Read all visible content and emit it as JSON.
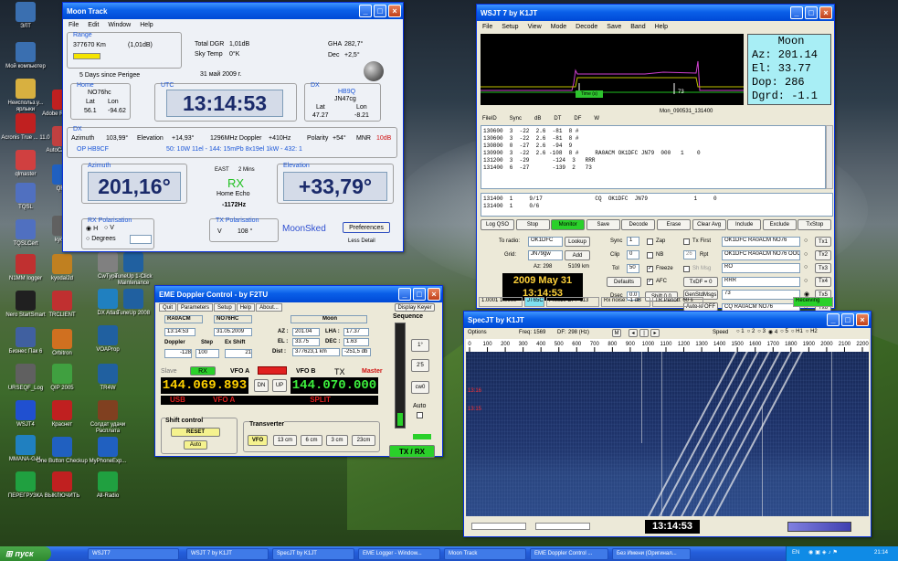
{
  "desktop": {
    "col1": [
      {
        "label": "ЭЛТ",
        "icon": "computer-icon",
        "color": "#3a6fb0"
      },
      {
        "label": "Мой компьютер",
        "icon": "computer-icon",
        "color": "#3a6fb0"
      },
      {
        "label": "Неиспольз.у... ярлыки",
        "icon": "folder-icon",
        "color": "#d8b040"
      },
      {
        "label": "Acronis True ... 11.0",
        "icon": "disc-icon",
        "color": "#c02020"
      },
      {
        "label": "qlmaster",
        "icon": "app-icon",
        "color": "#d04040"
      },
      {
        "label": "TQSL",
        "icon": "app-icon",
        "color": "#5070c0"
      },
      {
        "label": "TQSLCert",
        "icon": "app-icon",
        "color": "#5070c0"
      },
      {
        "label": "N1MM logger",
        "icon": "logger-icon",
        "color": "#c03030"
      },
      {
        "label": "Nero StartSmart",
        "icon": "disc-icon",
        "color": "#202020"
      },
      {
        "label": "Бизнес Пак 6",
        "icon": "app-icon",
        "color": "#4060a0"
      },
      {
        "label": "URSEQF_Log",
        "icon": "app-icon",
        "color": "#606060"
      },
      {
        "label": "WSJT4",
        "icon": "app-icon",
        "color": "#2050d0"
      },
      {
        "label": "MMANA-GAL",
        "icon": "antenna-icon",
        "color": "#2080c0"
      },
      {
        "label": "ПЕРЕГРУЗКА",
        "icon": "app-icon",
        "color": "#20a040"
      }
    ],
    "col2": [
      {
        "label": "Adobe Reader 9",
        "icon": "pdf-icon",
        "color": "#c02020"
      },
      {
        "label": "AutoCAD CB",
        "icon": "app-icon",
        "color": "#c04040"
      },
      {
        "label": "QRZ",
        "icon": "app-icon",
        "color": "#2060c0"
      },
      {
        "label": "kyoda",
        "icon": "app-icon",
        "color": "#606060"
      },
      {
        "label": "kyodai2d",
        "icon": "app-icon",
        "color": "#c08020"
      },
      {
        "label": "TRCLIENT",
        "icon": "app-icon",
        "color": "#c03030"
      },
      {
        "label": "Orbitron",
        "icon": "app-icon",
        "color": "#d07020"
      },
      {
        "label": "QIP 2005",
        "icon": "app-icon",
        "color": "#40a040"
      },
      {
        "label": "Краснет",
        "icon": "app-icon",
        "color": "#c02020"
      },
      {
        "label": "One Button Checkup",
        "icon": "app-icon",
        "color": "#2060c0"
      },
      {
        "label": "ВЫКЛЮЧИТЬ",
        "icon": "power-icon",
        "color": "#c02020"
      }
    ],
    "col3": [
      {
        "label": "CwType",
        "icon": "app-icon",
        "color": "#808080"
      },
      {
        "label": "DX Atlas",
        "icon": "globe-icon",
        "color": "#2080c0"
      },
      {
        "label": "VOAProp",
        "icon": "app-icon",
        "color": "#2060a0"
      },
      {
        "label": "TR4W",
        "icon": "app-icon",
        "color": "#2060a0"
      },
      {
        "label": "Солдат удачи Расплата",
        "icon": "game-icon",
        "color": "#804020"
      },
      {
        "label": "MyPhoneExp...",
        "icon": "phone-icon",
        "color": "#2060c0"
      },
      {
        "label": "All-Radio",
        "icon": "radio-icon",
        "color": "#20a040"
      }
    ],
    "col4": [
      {
        "label": "TuneUp 1-Click Maintenance",
        "icon": "app-icon",
        "color": "#2060a0"
      },
      {
        "label": "TuneUp 2008",
        "icon": "app-icon",
        "color": "#2060a0"
      }
    ]
  },
  "moon": {
    "title": "Moon Track",
    "menu": [
      "File",
      "Edit",
      "Window",
      "Help"
    ],
    "range_title": "Range",
    "range_km": "377670 Km",
    "range_db": "(1,01dB)",
    "perigee": "5  Days since Perigee",
    "total_dgr_l": "Total DGR",
    "total_dgr": "1,01dB",
    "sky_l": "Sky Temp",
    "sky": "0°K",
    "gha_l": "GHA",
    "gha": "282,7°",
    "dec_l": "Dec",
    "dec": "+2,5°",
    "date": "31 май 2009 г.",
    "home_title": "Home",
    "home_call": "NO76hc",
    "lat_l": "Lat",
    "lon_l": "Lon",
    "home_lat": "56.1",
    "home_lon": "-94.62",
    "utc_title": "UTC",
    "utc": "13:14:53",
    "dx_title": "DX",
    "dx_call": "HB9Q",
    "dx_grid": "JN47cg",
    "dx_lat": "47.27",
    "dx_lon": "-8.21",
    "dx2_title": "DX",
    "azimuth_l": "Azimuth",
    "azimuth_v": "103,99°",
    "elev_l": "Elevation",
    "elev_v": "+14,93°",
    "doppler": "1296MHz Doppler",
    "doppler_v": "+410Hz",
    "polarity_l": "Polarity",
    "polarity_v": "+54°",
    "mnr_l": "MNR",
    "mnr_v": "10dB",
    "dxcall": "OP HB9CF",
    "sked": "50: 10W 11el - 144: 15mPb 8x19el 1kW - 432: 1",
    "az_title": "Azimuth",
    "az_big": "201,16°",
    "east": "EAST",
    "mins": "2 Mins",
    "rx": "RX",
    "home_echo": "Home Echo",
    "echo": "-1172Hz",
    "el_title": "Elevation",
    "el_big": "+33,79°",
    "rxpol_title": "RX Polarisation",
    "txpol_title": "TX Polarisation",
    "pol_h": "H",
    "pol_v": "V",
    "pol_deg": "Degrees",
    "tx_v": "V",
    "tx_deg": "108 °",
    "moonsked": "MoonSked",
    "prefs": "Preferences",
    "less": "Less Detail"
  },
  "eme": {
    "title": "EME Doppler Control   - by F2TU",
    "tabs": [
      "Quit",
      "Parameters",
      "Setup",
      "Help",
      "About..."
    ],
    "display_keyer": "Display Keyer",
    "sequence": "Sequence",
    "call1": "RA0ACM",
    "call2": "NO76HC",
    "moon": "Moon",
    "time": "13:14:53",
    "date": "31.05.2009",
    "az_l": "AZ :",
    "az": "201.04",
    "lha_l": "LHA :",
    "lha": "17.37",
    "el_l": "EL :",
    "el": "33.75",
    "dec_l": "DEC :",
    "dec": "1.63",
    "dist_l": "Dist :",
    "dist": "377623,1 km",
    "dist2": "-251,5 db",
    "doppler_l": "Doppler",
    "step_l": "Step",
    "exshift_l": "Ex Shift",
    "doppler": "-128",
    "step": "100",
    "exshift": "21",
    "slave": "Slave",
    "rx": "RX",
    "vfoa_l": "VFO A",
    "vfob_l": "VFO B",
    "tx": "TX",
    "master": "Master",
    "freq_a": "144.069.893",
    "dn": "DN",
    "up": "UP",
    "freq_b": "144.070.000",
    "usb": "USB",
    "vfoa": "VFO A",
    "split": "SPLIT",
    "seq1": "1°",
    "seq2": "2'5",
    "cw": "cw0",
    "auto_l": "Auto",
    "shift_title": "Shift control",
    "reset": "RESET",
    "auto": "Auto",
    "transverter": "Transverter",
    "vfo": "VFO",
    "b13": "13 cm",
    "b6": "6 cm",
    "b3": "3 cm",
    "b23": "23cm",
    "txrx": "TX / RX"
  },
  "wsjt": {
    "title": "WSJT 7    by K1JT",
    "menu": [
      "File",
      "Setup",
      "View",
      "Mode",
      "Decode",
      "Save",
      "Band",
      "Help"
    ],
    "moon_panel": {
      "title": "Moon",
      "az": "Az: 201.14",
      "el": "El:  33.77",
      "dop": "Dop:    286",
      "dgrd": "Dgrd:  -1.1"
    },
    "spectrum_lbl": "Time (s)",
    "file": "Mon_090531_131400",
    "cols": [
      "FileID",
      "Sync",
      "dB",
      "DT",
      "DF",
      "W"
    ],
    "lines": [
      "130600  3  -22  2.6  -81  8 #",
      "130600  3  -22  2.6  -81  8 #",
      "130800  0  -27  2.6  -94  9",
      "130900  3  -22  2.6 -108  8 #     RA0ACM OK1DFC JN79  000   1    0",
      "131200  3  -29       -124  3   RRR",
      "131400  6  -27       -139  2   73"
    ],
    "lines2": [
      "131400  1     9/17                CQ  OK1DFC  JN79              1     0",
      "131400  1     0/6"
    ],
    "buttons": [
      "Log QSO",
      "Stop",
      "Monitor",
      "Save",
      "Decode",
      "Erase",
      "Clear Avg",
      "Include",
      "Exclude",
      "TxStop"
    ],
    "to_radio_l": "To radio:",
    "to_radio": "OK1DFC",
    "lookup": "Lookup",
    "grid_l": "Grid:",
    "grid": "JN79gw",
    "add": "Add",
    "az_km": "Az: 298",
    "km": "5109 km",
    "date": "2009 May 31",
    "time": "13:14:53",
    "sync_l": "Sync",
    "sync": "1",
    "clip_l": "Clip",
    "clip": "0",
    "tol_l": "Tol",
    "tol": "50",
    "defaults": "Defaults",
    "dsec_l": "Dsec",
    "dsec": "0.0",
    "shift": "Shift 0.0",
    "zap": "Zap",
    "nb": "NB",
    "freeze": "Freeze",
    "afc": "AFC",
    "txfirst": "Tx First",
    "rpt_l": "Rpt",
    "rpt": "26",
    "shmsg": "Sh Msg",
    "txdf": "TxDF = 0",
    "gen": "GenStdMsgs",
    "auto_off": "Auto is OFF",
    "tx_msgs": [
      "OK1DFC RA0ACM NO76",
      "OK1DFC RA0ACM NO76 OOO",
      "RO",
      "RRR",
      "73",
      "CQ RA0ACM NO76"
    ],
    "tx_btns": [
      "Tx1",
      "Tx2",
      "Tx3",
      "Tx4",
      "Tx5",
      "Tx6"
    ],
    "status": [
      "1.0001 1.0000",
      "JT65C",
      "Freeze DF: -113",
      "Rx noise: -1 dB",
      "TR Period: 60 s",
      "Receiving"
    ]
  },
  "spec": {
    "title": "SpecJT    by K1JT",
    "options": "Options",
    "freq_l": "Freq:",
    "freq": "1569",
    "df_l": "DF:",
    "df": "298 (Hz)",
    "speed_l": "Speed",
    "speeds": [
      "1",
      "2",
      "3",
      "4",
      "5"
    ],
    "h1": "H1",
    "h2": "H2",
    "ticks": [
      "0",
      "100",
      "200",
      "300",
      "400",
      "500",
      "600",
      "700",
      "800",
      "900",
      "1000",
      "1100",
      "1200",
      "1300",
      "1400",
      "1500",
      "1600",
      "1700",
      "1800",
      "1900",
      "2000",
      "2100",
      "2200"
    ],
    "marks": [
      "13:16",
      "13:15"
    ],
    "time": "13:14:53"
  },
  "taskbar": {
    "start": "пуск",
    "tasks": [
      "WSJT7",
      "WSJT 7  by K1JT",
      "SpecJT   by K1JT",
      "EME Logger - Window...",
      "Moon Track",
      "EME Doppler Control ...",
      "Без Имени (Оригинал..."
    ],
    "lang": "EN",
    "clock": "21:14"
  }
}
